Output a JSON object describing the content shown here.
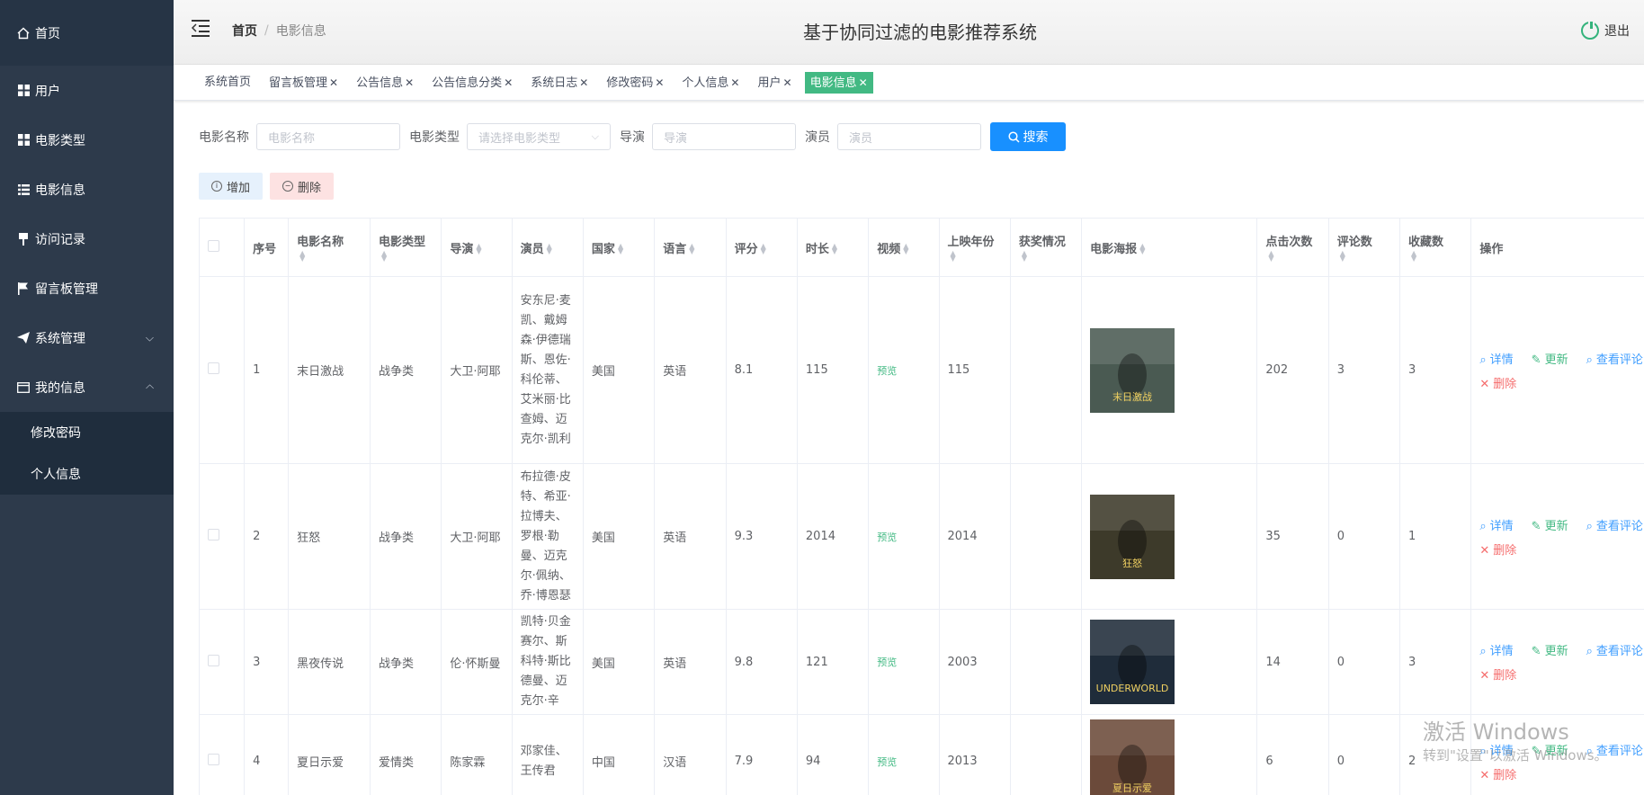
{
  "sidebar": {
    "items": [
      {
        "label": "首页",
        "icon": "home-icon"
      },
      {
        "label": "用户",
        "icon": "grid-icon"
      },
      {
        "label": "电影类型",
        "icon": "grid-icon"
      },
      {
        "label": "电影信息",
        "icon": "list-icon"
      },
      {
        "label": "访问记录",
        "icon": "push-pin-icon"
      },
      {
        "label": "留言板管理",
        "icon": "flag-icon"
      },
      {
        "label": "系统管理",
        "icon": "send-icon"
      },
      {
        "label": "我的信息",
        "icon": "card-icon"
      }
    ],
    "sub_items": [
      {
        "label": "修改密码"
      },
      {
        "label": "个人信息"
      }
    ]
  },
  "header": {
    "breadcrumb_home": "首页",
    "breadcrumb_sep": "/",
    "breadcrumb_current": "电影信息",
    "title": "基于协同过滤的电影推荐系统",
    "logout": "退出"
  },
  "tags": [
    {
      "label": "系统首页",
      "closable": false
    },
    {
      "label": "留言板管理",
      "closable": true
    },
    {
      "label": "公告信息",
      "closable": true
    },
    {
      "label": "公告信息分类",
      "closable": true
    },
    {
      "label": "系统日志",
      "closable": true
    },
    {
      "label": "修改密码",
      "closable": true
    },
    {
      "label": "个人信息",
      "closable": true
    },
    {
      "label": "用户",
      "closable": true
    },
    {
      "label": "电影信息",
      "closable": true,
      "active": true
    }
  ],
  "search": {
    "name_label": "电影名称",
    "name_placeholder": "电影名称",
    "type_label": "电影类型",
    "type_placeholder": "请选择电影类型",
    "director_label": "导演",
    "director_placeholder": "导演",
    "actor_label": "演员",
    "actor_placeholder": "演员",
    "button": "搜索"
  },
  "actions": {
    "add": "增加",
    "delete": "删除"
  },
  "table": {
    "headers": [
      "序号",
      "电影名称",
      "电影类型",
      "导演",
      "演员",
      "国家",
      "语言",
      "评分",
      "时长",
      "视频",
      "上映年份",
      "获奖情况",
      "电影海报",
      "点击次数",
      "评论数",
      "收藏数",
      "操作"
    ],
    "preview_label": "预览",
    "op_labels": {
      "detail": "详情",
      "update": "更新",
      "comments": "查看评论",
      "remove": "删除"
    },
    "rows": [
      {
        "no": "1",
        "name": "末日激战",
        "type": "战争类",
        "director": "大卫·阿耶",
        "actors": "安东尼·麦凯、戴姆森·伊德瑞斯、恩佐·科伦蒂、艾米丽·比查姆、迈克尔·凯利",
        "country": "美国",
        "language": "英语",
        "score": "8.1",
        "duration": "115",
        "year": "115",
        "awards": "",
        "poster_text": "末日激战",
        "poster_color": "#4a5a52",
        "clicks": "202",
        "comments": "3",
        "favorites": "3"
      },
      {
        "no": "2",
        "name": "狂怒",
        "type": "战争类",
        "director": "大卫·阿耶",
        "actors": "布拉德·皮特、希亚·拉博夫、罗根·勒曼、迈克尔·佩纳、乔·博恩瑟",
        "country": "美国",
        "language": "英语",
        "score": "9.3",
        "duration": "2014",
        "year": "2014",
        "awards": "",
        "poster_text": "狂怒",
        "poster_color": "#3d3a2a",
        "clicks": "35",
        "comments": "0",
        "favorites": "1"
      },
      {
        "no": "3",
        "name": "黑夜传说",
        "type": "战争类",
        "director": "伦·怀斯曼",
        "actors": "凯特·贝金赛尔、斯科特·斯比德曼、迈克尔·辛",
        "country": "美国",
        "language": "英语",
        "score": "9.8",
        "duration": "121",
        "year": "2003",
        "awards": "",
        "poster_text": "UNDERWORLD",
        "poster_color": "#1f2c3a",
        "clicks": "14",
        "comments": "0",
        "favorites": "3"
      },
      {
        "no": "4",
        "name": "夏日示爱",
        "type": "爱情类",
        "director": "陈家霖",
        "actors": "邓家佳、王传君",
        "country": "中国",
        "language": "汉语",
        "score": "7.9",
        "duration": "94",
        "year": "2013",
        "awards": "",
        "poster_text": "夏日示爱",
        "poster_color": "#6b4a3a",
        "clicks": "6",
        "comments": "0",
        "favorites": "2"
      }
    ]
  },
  "watermark": {
    "line1": "激活 Windows",
    "line2": "转到\"设置\"以激活 Windows。"
  },
  "colors": {
    "sidebar_bg": "#2d3a4b",
    "accent_green": "#42b983",
    "primary_blue": "#1890ff",
    "danger": "#f56c6c"
  }
}
